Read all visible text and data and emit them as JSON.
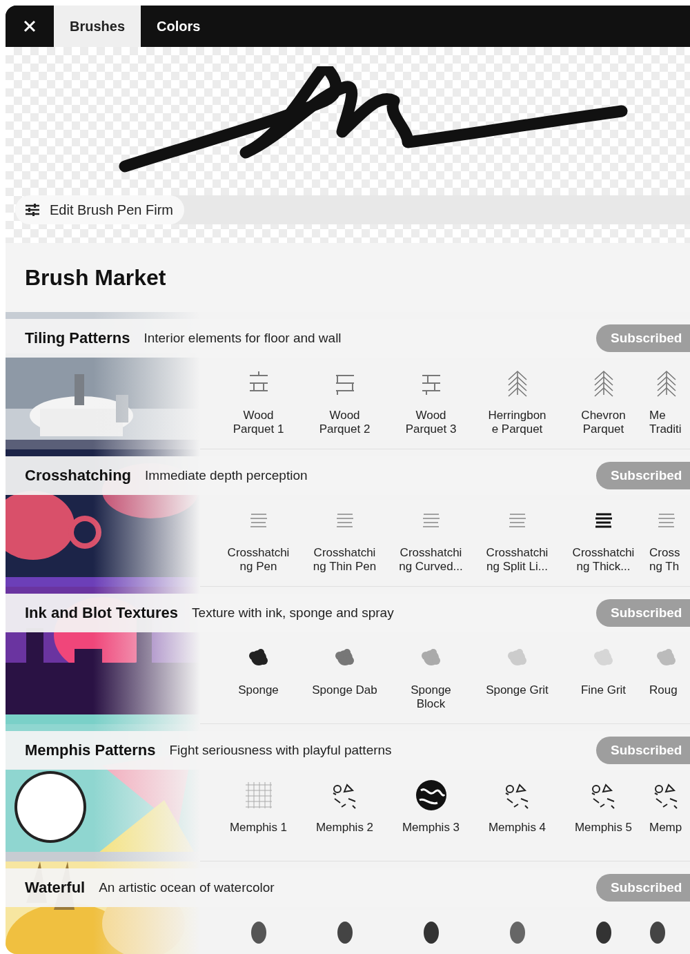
{
  "tabs": [
    {
      "label": "Brushes",
      "selected": true
    },
    {
      "label": "Colors",
      "selected": false
    }
  ],
  "edit_button": {
    "label": "Edit Brush Pen Firm"
  },
  "market_title": "Brush Market",
  "sections": [
    {
      "title": "Tiling Patterns",
      "subtitle": "Interior elements for floor and wall",
      "button": "Subscribed",
      "items": [
        {
          "kind": "parquet",
          "lines": [
            "Wood",
            "Parquet 1"
          ]
        },
        {
          "kind": "parquet",
          "lines": [
            "Wood",
            "Parquet 2"
          ]
        },
        {
          "kind": "parquet",
          "lines": [
            "Wood",
            "Parquet 3"
          ]
        },
        {
          "kind": "chevron",
          "lines": [
            "Herringbon",
            "e Parquet"
          ]
        },
        {
          "kind": "chevron",
          "lines": [
            "Chevron",
            "Parquet"
          ]
        },
        {
          "kind": "chevron",
          "lines": [
            "Me",
            "Traditi"
          ]
        }
      ]
    },
    {
      "title": "Crosshatching",
      "subtitle": "Immediate depth perception",
      "button": "Subscribed",
      "items": [
        {
          "kind": "hatch",
          "lines": [
            "Crosshatchi",
            "ng Pen"
          ]
        },
        {
          "kind": "hatch",
          "lines": [
            "Crosshatchi",
            "ng Thin Pen"
          ]
        },
        {
          "kind": "hatch",
          "lines": [
            "Crosshatchi",
            "ng Curved..."
          ]
        },
        {
          "kind": "hatch",
          "lines": [
            "Crosshatchi",
            "ng Split Li..."
          ]
        },
        {
          "kind": "hatch",
          "lines": [
            "Crosshatchi",
            "ng Thick..."
          ]
        },
        {
          "kind": "hatch",
          "lines": [
            "Cross",
            "ng Th"
          ]
        }
      ]
    },
    {
      "title": "Ink and Blot Textures",
      "subtitle": "Texture with ink, sponge and spray",
      "button": "Subscribed",
      "items": [
        {
          "kind": "blot",
          "lines": [
            "Sponge"
          ]
        },
        {
          "kind": "blot",
          "lines": [
            "Sponge Dab"
          ]
        },
        {
          "kind": "blot",
          "lines": [
            "Sponge",
            "Block"
          ]
        },
        {
          "kind": "blot",
          "lines": [
            "Sponge Grit"
          ]
        },
        {
          "kind": "blot",
          "lines": [
            "Fine Grit"
          ]
        },
        {
          "kind": "blot",
          "lines": [
            "Roug"
          ]
        }
      ]
    },
    {
      "title": "Memphis Patterns",
      "subtitle": "Fight seriousness with playful patterns",
      "button": "Subscribed",
      "items": [
        {
          "kind": "memphis",
          "lines": [
            "Memphis 1"
          ]
        },
        {
          "kind": "memphis",
          "lines": [
            "Memphis 2"
          ]
        },
        {
          "kind": "memphis",
          "lines": [
            "Memphis 3"
          ]
        },
        {
          "kind": "memphis",
          "lines": [
            "Memphis 4"
          ]
        },
        {
          "kind": "memphis",
          "lines": [
            "Memphis 5"
          ]
        },
        {
          "kind": "memphis",
          "lines": [
            "Memp"
          ]
        }
      ]
    },
    {
      "title": "Waterful",
      "subtitle": "An artistic ocean of watercolor",
      "button": "Subscribed",
      "items": [
        {
          "kind": "drop"
        },
        {
          "kind": "drop"
        },
        {
          "kind": "drop"
        },
        {
          "kind": "drop"
        },
        {
          "kind": "drop"
        },
        {
          "kind": "drop"
        }
      ]
    }
  ]
}
